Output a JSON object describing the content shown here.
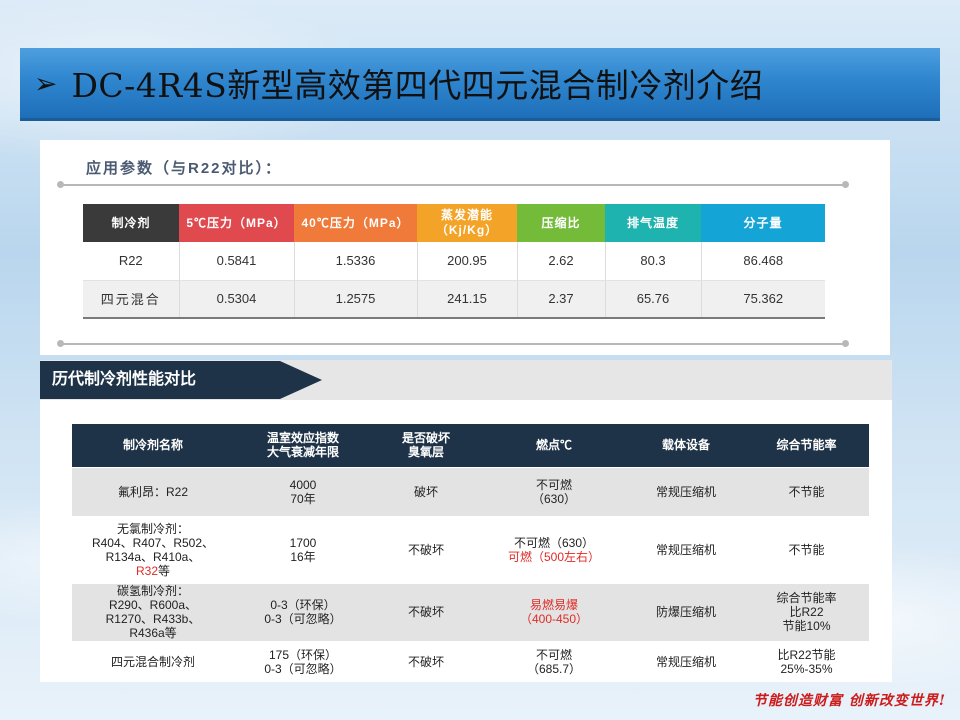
{
  "title": {
    "arrow": "➢",
    "text": "DC-4R4S新型高效第四代四元混合制冷剂介绍"
  },
  "params": {
    "heading": "应用参数（与R22对比）：",
    "headers": [
      "制冷剂",
      "5℃压力（MPa）",
      "40℃压力（MPa）",
      "蒸发潜能（Kj/Kg）",
      "压缩比",
      "排气温度",
      "分子量"
    ],
    "rows": [
      [
        "R22",
        "0.5841",
        "1.5336",
        "200.95",
        "2.62",
        "80.3",
        "86.468"
      ],
      [
        "四元混合",
        "0.5304",
        "1.2575",
        "241.15",
        "2.37",
        "65.76",
        "75.362"
      ]
    ]
  },
  "history": {
    "banner": "历代制冷剂性能对比",
    "headers": [
      [
        "制冷剂名称"
      ],
      [
        "温室效应指数",
        "大气衰减年限"
      ],
      [
        "是否破坏",
        "臭氧层"
      ],
      [
        "燃点℃"
      ],
      [
        "载体设备"
      ],
      [
        "综合节能率"
      ]
    ],
    "rows": [
      {
        "name": [
          "氟利昂：R22"
        ],
        "gwp": [
          "4000",
          "70年"
        ],
        "ozone": [
          "破坏"
        ],
        "flash": [
          {
            "t": "不可燃",
            "red": false
          },
          {
            "t": "（630）",
            "red": false
          }
        ],
        "device": [
          "常规压缩机"
        ],
        "saving": [
          "不节能"
        ]
      },
      {
        "name": [
          "无氯制冷剂：",
          "R404、R407、R502、",
          "R134a、R410a、",
          "R32等"
        ],
        "gwp": [
          "1700",
          "16年"
        ],
        "ozone": [
          "不破坏"
        ],
        "flash": [
          {
            "t": "不可燃（630）",
            "red": false
          },
          {
            "t": "可燃（500左右）",
            "red": true
          }
        ],
        "device": [
          "常规压缩机"
        ],
        "saving": [
          "不节能"
        ]
      },
      {
        "name": [
          "碳氢制冷剂：",
          "R290、R600a、",
          "R1270、R433b、",
          "R436a等"
        ],
        "gwp": [
          "0-3（环保）",
          "0-3（可忽略）"
        ],
        "ozone": [
          "不破坏"
        ],
        "flash": [
          {
            "t": "易燃易爆",
            "red": true
          },
          {
            "t": "（400-450）",
            "red": true
          }
        ],
        "device": [
          "防爆压缩机"
        ],
        "saving": [
          "综合节能率",
          "比R22",
          "节能10%"
        ]
      },
      {
        "name": [
          "四元混合制冷剂"
        ],
        "gwp": [
          "175（环保）",
          "0-3（可忽略）"
        ],
        "ozone": [
          "不破坏"
        ],
        "flash": [
          {
            "t": "不可燃",
            "red": false
          },
          {
            "t": "（685.7）",
            "red": false
          }
        ],
        "device": [
          "常规压缩机"
        ],
        "saving": [
          "比R22节能",
          "25%-35%"
        ]
      }
    ]
  },
  "slogan": "节能创造财富 创新改变世界!",
  "colors": {
    "title_bar": "#2f86cf",
    "banner": "#1e3348",
    "header_palette": [
      "#3a3a3a",
      "#e04a4f",
      "#ef7a3a",
      "#f3a428",
      "#74bb3a",
      "#1fb3b0",
      "#15a4d6"
    ],
    "warning_red": "#e02b27"
  }
}
